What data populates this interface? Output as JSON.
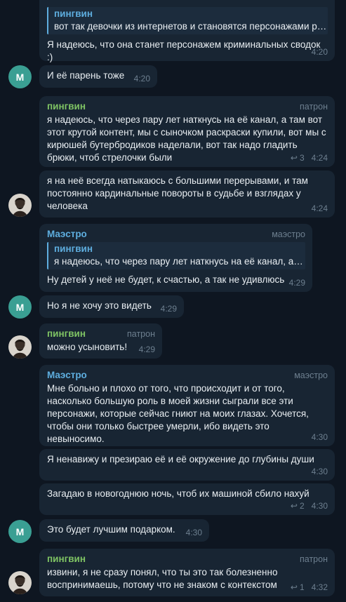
{
  "messages": {
    "m1": {
      "quote_name": "пингвин",
      "quote_text": "вот так девочки из интернетов и становятся персонажами ро...",
      "text": "Я надеюсь, что она станет персонажем криминальных сводок :)",
      "time": "4:20"
    },
    "m2": {
      "avatar": "М",
      "text": "И её парень тоже",
      "time": "4:20"
    },
    "m3": {
      "sender": "пингвин",
      "role": "патрон",
      "text": "я надеюсь, что через пару лет наткнусь на её канал, а там вот\nэтот крутой контент, мы с сыночком раскраски купили, вот мы с\nкирюшей бутербродиков наделали, вот так надо гладить\nбрюки, чтоб стрелочки были",
      "replies": "3",
      "time": "4:24"
    },
    "m4": {
      "text": "я на неё всегда натыкаюсь с большими перерывами, и там\nпостоянно кардинальные повороты в судьбе и взглядах у\nчеловека",
      "time": "4:24"
    },
    "m5": {
      "sender": "Маэстро",
      "role": "маэстро",
      "quote_name": "пингвин",
      "quote_text": "я надеюсь, что через пару лет наткнусь на её канал, а т...",
      "text": "Ну детей у неё не будет, к счастью, а так не удивлюсь",
      "time": "4:29"
    },
    "m6": {
      "avatar": "М",
      "text": "Но я не хочу это видеть",
      "time": "4:29"
    },
    "m7": {
      "sender": "пингвин",
      "role": "патрон",
      "text": "можно усыновить!",
      "time": "4:29"
    },
    "m8": {
      "sender": "Маэстро",
      "role": "маэстро",
      "text": "Мне больно и плохо от того, что происходит и от того,\nнасколько большую роль в моей жизни сыграли все эти\nперсонажи, которые сейчас гниют на моих глазах. Хочется,\nчтобы они только быстрее умерли, ибо видеть это невыносимо.",
      "time": "4:30"
    },
    "m9": {
      "text": "Я ненавижу и презираю её и её окружение до глубины души",
      "time": "4:30"
    },
    "m10": {
      "text": "Загадаю в новогоднюю ночь, чтоб их машиной сбило нахуй",
      "replies": "2",
      "time": "4:30"
    },
    "m11": {
      "avatar": "М",
      "text": "Это будет лучшим подарком.",
      "time": "4:30"
    },
    "m12": {
      "sender": "пингвин",
      "role": "патрон",
      "text": "извини, я не сразу понял, что ты это так болезненно\nвоспринимаешь, потому что не знаком с контекстом",
      "replies": "1",
      "time": "4:32"
    }
  },
  "colors": {
    "background": "#0e1621",
    "bubble": "#182533",
    "green_name": "#7fc464",
    "blue_name": "#5eaedf",
    "avatar_m": "#3a9f93"
  }
}
